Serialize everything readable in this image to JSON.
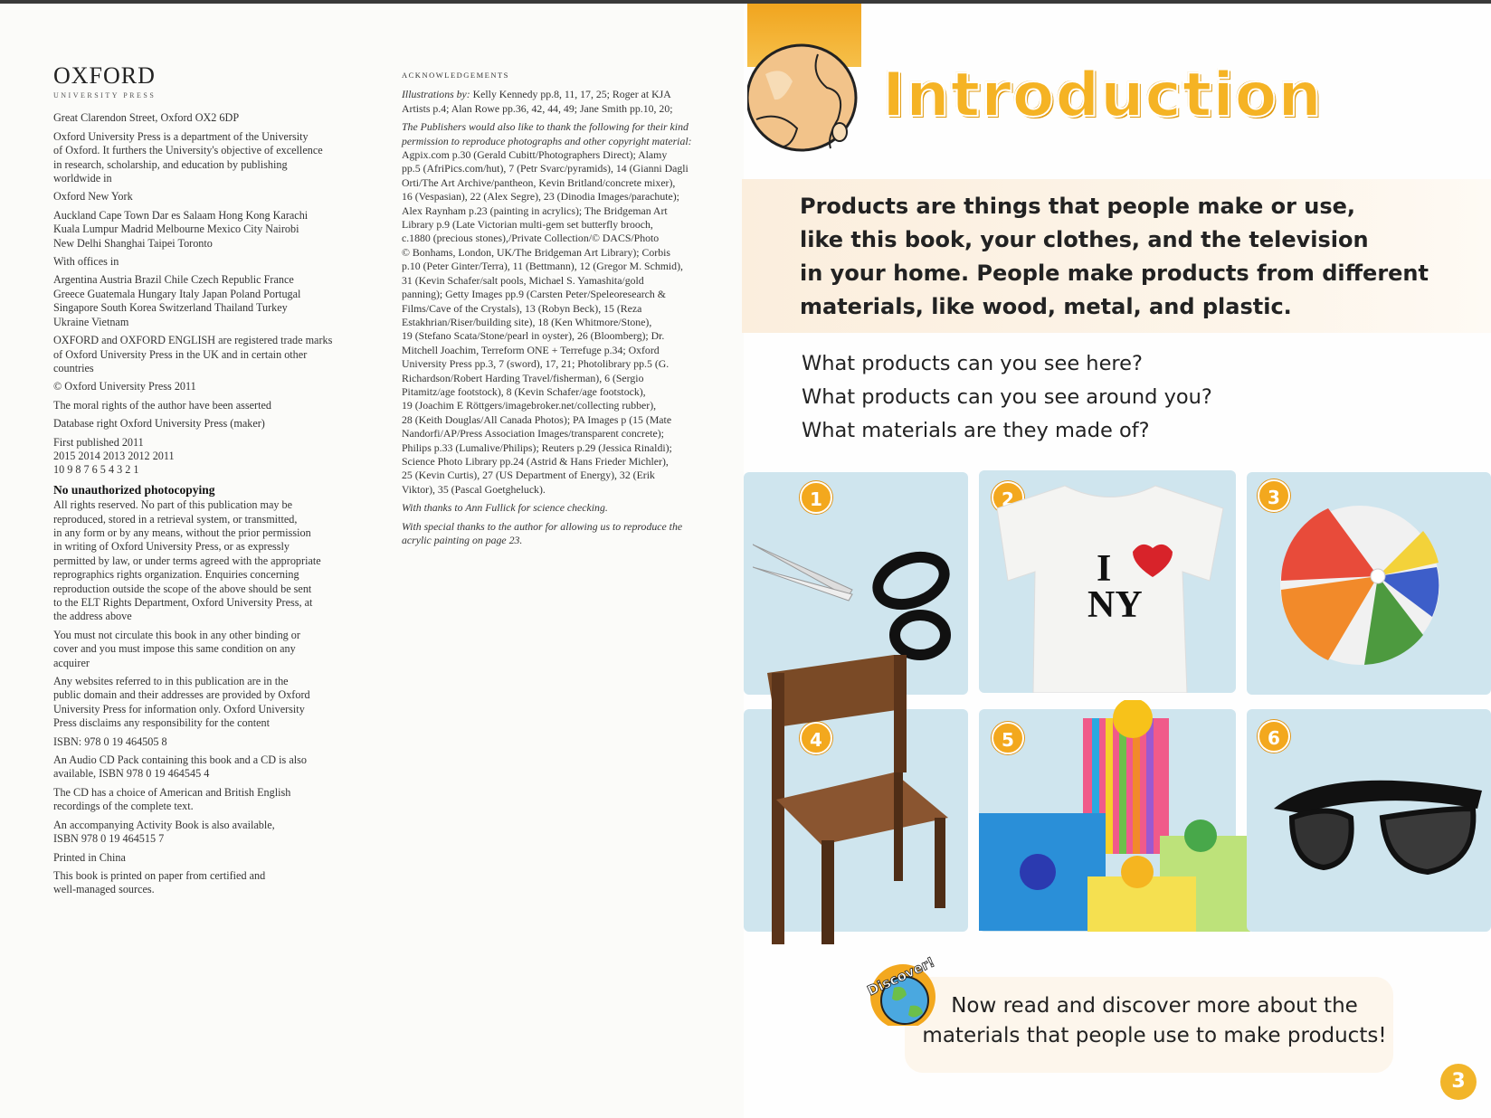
{
  "left_page": {
    "logo": {
      "name": "OXFORD",
      "sub": "UNIVERSITY PRESS"
    },
    "copyright": [
      "Great Clarendon Street, Oxford OX2 6DP",
      "Oxford University Press is a department of the University\nof Oxford. It furthers the University's objective of excellence\nin research, scholarship, and education by publishing\nworldwide in",
      "Oxford  New York",
      "Auckland  Cape Town  Dar es Salaam  Hong Kong  Karachi\nKuala Lumpur  Madrid  Melbourne  Mexico City  Nairobi\nNew Delhi  Shanghai  Taipei  Toronto",
      "With offices in",
      "Argentina  Austria  Brazil  Chile  Czech Republic  France\nGreece  Guatemala  Hungary  Italy  Japan  Poland  Portugal\nSingapore  South Korea  Switzerland  Thailand  Turkey\nUkraine  Vietnam",
      "OXFORD and OXFORD ENGLISH are registered trade marks\nof Oxford University Press in the UK and in certain other\ncountries",
      "© Oxford University Press 2011",
      "The moral rights of the author have been asserted",
      "Database right Oxford University Press (maker)",
      "First published 2011\n2015  2014  2013  2012  2011\n10  9  8  7  6  5  4  3  2  1"
    ],
    "heading": "No unauthorized photocopying",
    "rights": [
      "All rights reserved. No part of this publication may be\nreproduced, stored in a retrieval system, or transmitted,\nin any form or by any means, without the prior permission\nin writing of Oxford University Press, or as expressly\npermitted by law, or under terms agreed with the appropriate\nreprographics rights organization. Enquiries concerning\nreproduction outside the scope of the above should be sent\nto the ELT Rights Department, Oxford University Press, at\nthe address above",
      "You must not circulate this book in any other binding or\ncover and you must impose this same condition on any\nacquirer",
      "Any websites referred to in this publication are in the\npublic domain and their addresses are provided by Oxford\nUniversity Press for information only. Oxford University\nPress disclaims any responsibility for the content",
      "ISBN: 978 0 19 464505 8",
      "An Audio CD Pack containing this book and a CD is also\navailable, ISBN 978 0 19 464545 4",
      "The CD has a choice of American and British English\nrecordings of the complete text.",
      "An accompanying Activity Book is also available,\nISBN 978 0 19 464515 7",
      "Printed in China",
      "This book is printed on paper from certified and\nwell-managed sources."
    ],
    "acknowledgements": {
      "heading": "ACKNOWLEDGEMENTS",
      "illustrations_label": "Illustrations by:",
      "illustrations": " Kelly Kennedy pp.8, 11, 17, 25; Roger at KJA\nArtists p.4; Alan Rowe pp.36, 42, 44, 49; Jane Smith pp.10, 20;",
      "intro_italic": "The Publishers would also like to thank the following for their kind\npermission to reproduce photographs and other copyright material:",
      "credits": "Agpix.com p.30 (Gerald Cubitt/Photographers Direct); Alamy\npp.5 (AfriPics.com/hut), 7 (Petr Svarc/pyramids), 14 (Gianni Dagli\nOrti/The Art Archive/pantheon, Kevin Britland/concrete mixer),\n16 (Vespasian), 22 (Alex Segre), 23 (Dinodia Images/parachute);\nAlex Raynham p.23 (painting in acrylics); The Bridgeman Art\nLibrary p.9 (Late Victorian multi-gem set butterfly brooch,\nc.1880 (precious stones),/Private Collection/© DACS/Photo\n© Bonhams, London, UK/The Bridgeman Art Library); Corbis\np.10 (Peter Ginter/Terra), 11 (Bettmann), 12 (Gregor M. Schmid),\n31 (Kevin Schafer/salt pools, Michael S. Yamashita/gold\npanning); Getty Images pp.9 (Carsten Peter/Speleoresearch &\nFilms/Cave of the Crystals), 13 (Robyn Beck), 15 (Reza\nEstakhrian/Riser/building site), 18 (Ken Whitmore/Stone),\n19 (Stefano Scata/Stone/pearl in oyster), 26 (Bloomberg); Dr.\nMitchell Joachim, Terreform ONE + Terrefuge p.34; Oxford\nUniversity Press pp.3, 7 (sword), 17, 21; Photolibrary pp.5 (G.\nRichardson/Robert Harding Travel/fisherman), 6 (Sergio\nPitamitz/age footstock), 8 (Kevin Schafer/age footstock),\n19 (Joachim E Röttgers/imagebroker.net/collecting rubber),\n28 (Keith Douglas/All Canada Photos); PA Images p (15 (Mate\nNandorfi/AP/Press Association Images/transparent concrete);\nPhilips p.33 (Lumalive/Philips); Reuters p.29 (Jessica Rinaldi);\nScience Photo Library pp.24 (Astrid & Hans Frieder Michler),\n25 (Kevin Curtis), 27 (US Department of Energy), 32 (Erik\nViktor), 35 (Pascal Goetgheluck).",
      "thanks1": "With thanks to Ann Fullick for science checking.",
      "thanks2": "With special thanks to the author for allowing us to reproduce the\nacrylic painting on page 23."
    }
  },
  "right_page": {
    "title": "Introduction",
    "intro": "Products are things that people make or use,\nlike this book, your clothes, and the television\nin your home. People make products from different\nmaterials, like wood, metal, and plastic.",
    "questions": [
      "What products can you see here?",
      "What products can you see around you?",
      "What materials are they made of?"
    ],
    "photos": [
      {
        "number": "1",
        "icon": "scissors-icon"
      },
      {
        "number": "2",
        "icon": "t-shirt-icon",
        "print_top": "I",
        "print_bottom": "NY"
      },
      {
        "number": "3",
        "icon": "beach-ball-icon"
      },
      {
        "number": "4",
        "icon": "chair-icon"
      },
      {
        "number": "5",
        "icon": "gift-boxes-icon"
      },
      {
        "number": "6",
        "icon": "sunglasses-icon"
      }
    ],
    "discover": {
      "badge": "Discover!",
      "text": "Now read and discover more about the\nmaterials that people use to make products!"
    },
    "page_number": "3",
    "colors": {
      "accent": "#f3a81e",
      "band": "#fbeedd",
      "photo_bg": "#cfe5ee"
    }
  }
}
